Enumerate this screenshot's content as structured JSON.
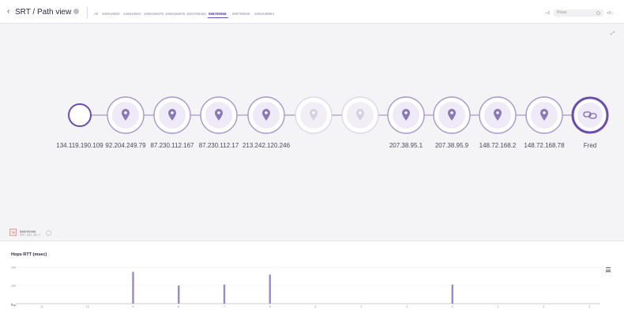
{
  "header": {
    "back": "‹",
    "title": "SRT / Path view",
    "tabs": [
      "All",
      "340610920",
      "340610922",
      "1060184676",
      "1060184876",
      "3203768462",
      "558790958",
      "508790940",
      "1092435864"
    ],
    "active_tab": 6,
    "nav_left": "‹-0",
    "search_placeholder": "Rows",
    "nav_right": "+0 ›"
  },
  "path": {
    "hops": [
      {
        "label": "134.119.190.109",
        "type": "source"
      },
      {
        "label": "92.204.249.79",
        "type": "hop"
      },
      {
        "label": "87.230.112.167",
        "type": "hop"
      },
      {
        "label": "87.230.112.17",
        "type": "hop"
      },
      {
        "label": "213.242.120.246",
        "type": "hop"
      },
      {
        "label": "",
        "type": "unknown"
      },
      {
        "label": "",
        "type": "unknown"
      },
      {
        "label": "207.38.95.1",
        "type": "hop"
      },
      {
        "label": "207.38.95.9",
        "type": "hop"
      },
      {
        "label": "148.72.168.2",
        "type": "hop"
      },
      {
        "label": "148.72.168.78",
        "type": "hop"
      },
      {
        "label": "Fred",
        "type": "destination"
      }
    ]
  },
  "selected": {
    "badge": "78",
    "id": "558790958",
    "sub": "SRT, 1R0, 4M, 0"
  },
  "rtt_chart": {
    "title": "Hops RTT (msec)",
    "menu_icon": "hamburger-icon"
  },
  "chart_data": {
    "type": "bar",
    "title": "Hops RTT (msec)",
    "x_label": "Hop",
    "categories": [
      "11",
      "10",
      "9",
      "8",
      "7",
      "6",
      "5",
      "4",
      "3",
      "2",
      "1",
      "0",
      "-1"
    ],
    "values": [
      0,
      0,
      1750,
      1000,
      1050,
      1600,
      0,
      0,
      0,
      1050,
      0,
      0,
      0
    ],
    "y_ticks": [
      "200",
      "100",
      "0"
    ],
    "ylim": [
      0,
      2000
    ],
    "bar_color": "#9b88c6"
  },
  "colors": {
    "accent": "#6a4cb0",
    "node_fill": "#efeaf7",
    "node_ring": "#a597c9"
  }
}
